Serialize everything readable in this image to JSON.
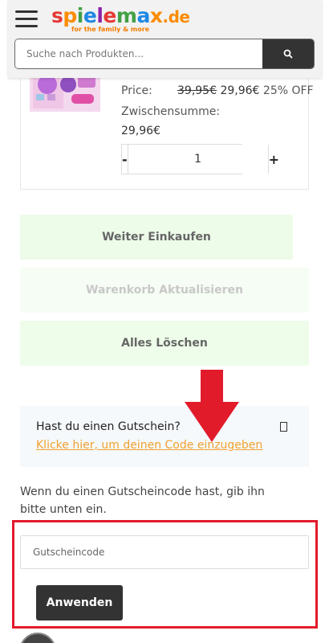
{
  "header": {
    "logo": {
      "word": [
        "s",
        "p",
        "i",
        "e",
        "l",
        "e",
        "m",
        "a",
        "x"
      ],
      "suffix": ".de",
      "tagline": "for the family & more"
    },
    "search": {
      "placeholder": "Suche nach Produkten...",
      "icon": "search-icon"
    },
    "menu_icon": "hamburger-menu-icon"
  },
  "product": {
    "price_label": "Price:",
    "old_price": "39,95€",
    "new_price": "29,96€",
    "discount": "25% OFF",
    "subtotal_label": "Zwischensumme:",
    "subtotal_value": "29,96€",
    "quantity": {
      "minus": "-",
      "value": "1",
      "plus": "+"
    }
  },
  "actions": {
    "continue_label": "Weiter Einkaufen",
    "update_label": "Warenkorb Aktualisieren",
    "clear_label": "Alles Löschen"
  },
  "coupon": {
    "question": "Hast du einen Gutschein?",
    "link": "Klicke hier, um deinen Code einzugeben",
    "help": "Wenn du einen Gutscheincode hast, gib ihn bitte unten ein.",
    "placeholder": "Gutscheincode",
    "apply_label": "Anwenden"
  },
  "colors": {
    "accent_orange": "#f0a030",
    "highlight_red": "#e21b2b",
    "dark_button": "#333333",
    "light_green": "#edfbe9"
  }
}
